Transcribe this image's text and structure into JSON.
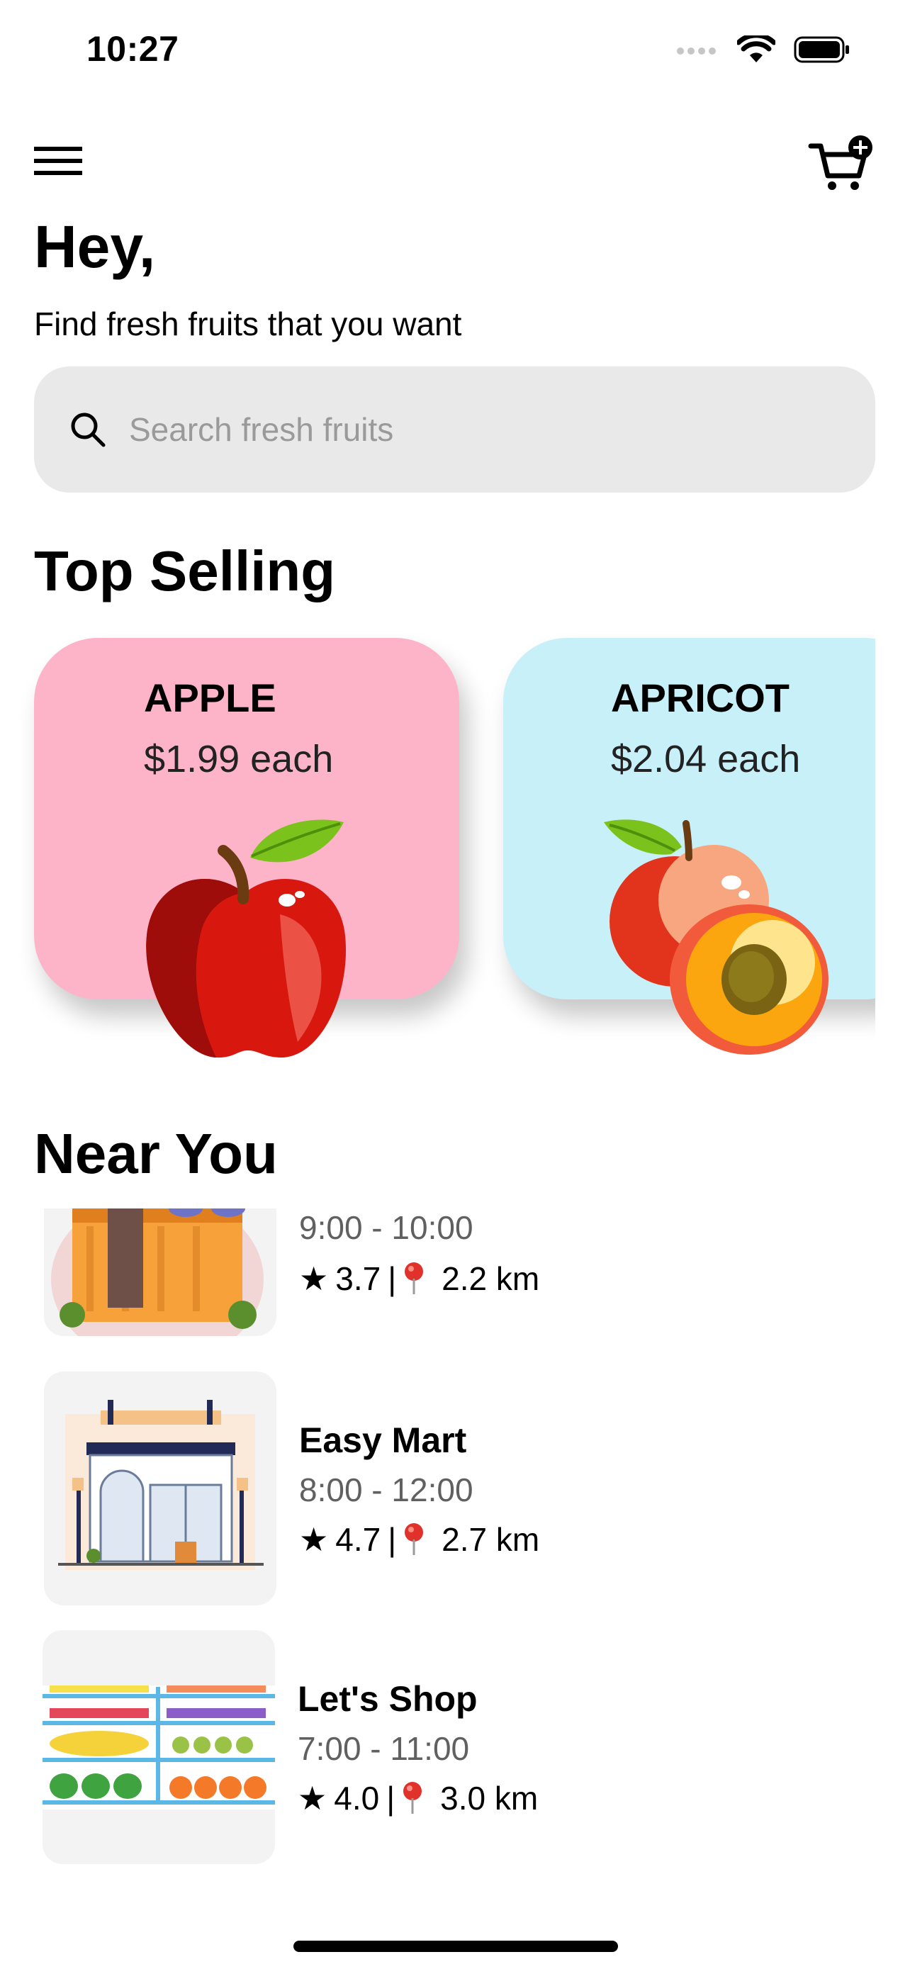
{
  "status_bar": {
    "time": "10:27",
    "icons": [
      "cellular-signal-icon",
      "wifi-icon",
      "battery-icon"
    ]
  },
  "header": {
    "menu_icon": "hamburger-menu-icon",
    "cart_icon": "cart-add-icon"
  },
  "greeting": {
    "title": "Hey,",
    "subtitle": "Find fresh fruits that you want"
  },
  "search": {
    "placeholder": "Search fresh fruits",
    "value": "",
    "icon": "search-icon"
  },
  "top_selling": {
    "title": "Top Selling",
    "items": [
      {
        "name": "APPLE",
        "price": "$1.99 each",
        "bg_color": "#fdb4c9",
        "image": "apple-illustration"
      },
      {
        "name": "APRICOT",
        "price": "$2.04 each",
        "bg_color": "#c8f0f9",
        "image": "apricot-illustration"
      }
    ]
  },
  "near_you": {
    "title": "Near You",
    "shops": [
      {
        "name": "",
        "hours": "9:00 - 10:00",
        "rating": "3.7",
        "distance": "2.2 km",
        "image": "fruit-stall-illustration"
      },
      {
        "name": "Easy Mart",
        "hours": "8:00 - 12:00",
        "rating": "4.7",
        "distance": "2.7 km",
        "image": "storefront-illustration"
      },
      {
        "name": "Let's Shop",
        "hours": "7:00 - 11:00",
        "rating": "4.0",
        "distance": "3.0 km",
        "image": "produce-shelves-illustration"
      }
    ],
    "rating_icon": "star-icon",
    "distance_icon": "location-pin-icon",
    "separator": "|"
  }
}
